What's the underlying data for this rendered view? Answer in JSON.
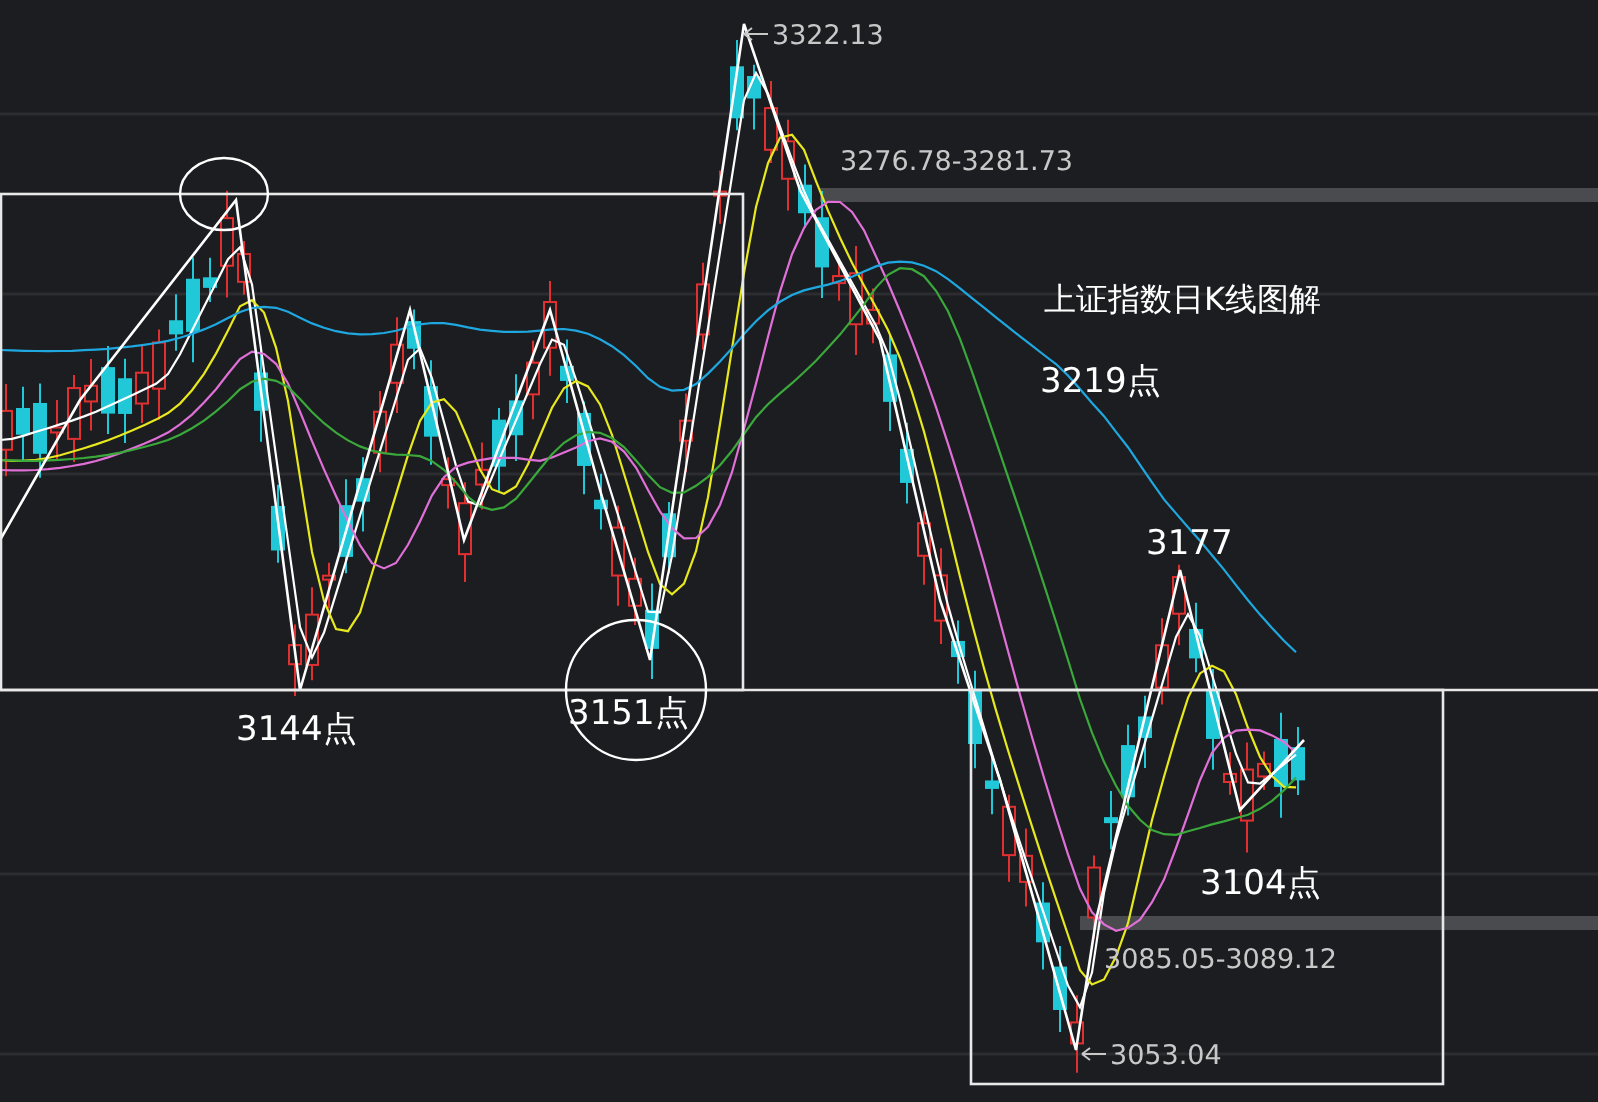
{
  "chart_title": "上证指数日K线图解",
  "annotations": [
    {
      "kind": "extreme",
      "text": "3322.13"
    },
    {
      "kind": "range",
      "text": "3276.78-3281.73"
    },
    {
      "kind": "point",
      "text": "3219点"
    },
    {
      "kind": "point",
      "text": "3177"
    },
    {
      "kind": "point",
      "text": "3144点"
    },
    {
      "kind": "point",
      "text": "3151点"
    },
    {
      "kind": "point",
      "text": "3104点"
    },
    {
      "kind": "range",
      "text": "3085.05-3089.12"
    },
    {
      "kind": "extreme",
      "text": "3053.04"
    }
  ]
}
